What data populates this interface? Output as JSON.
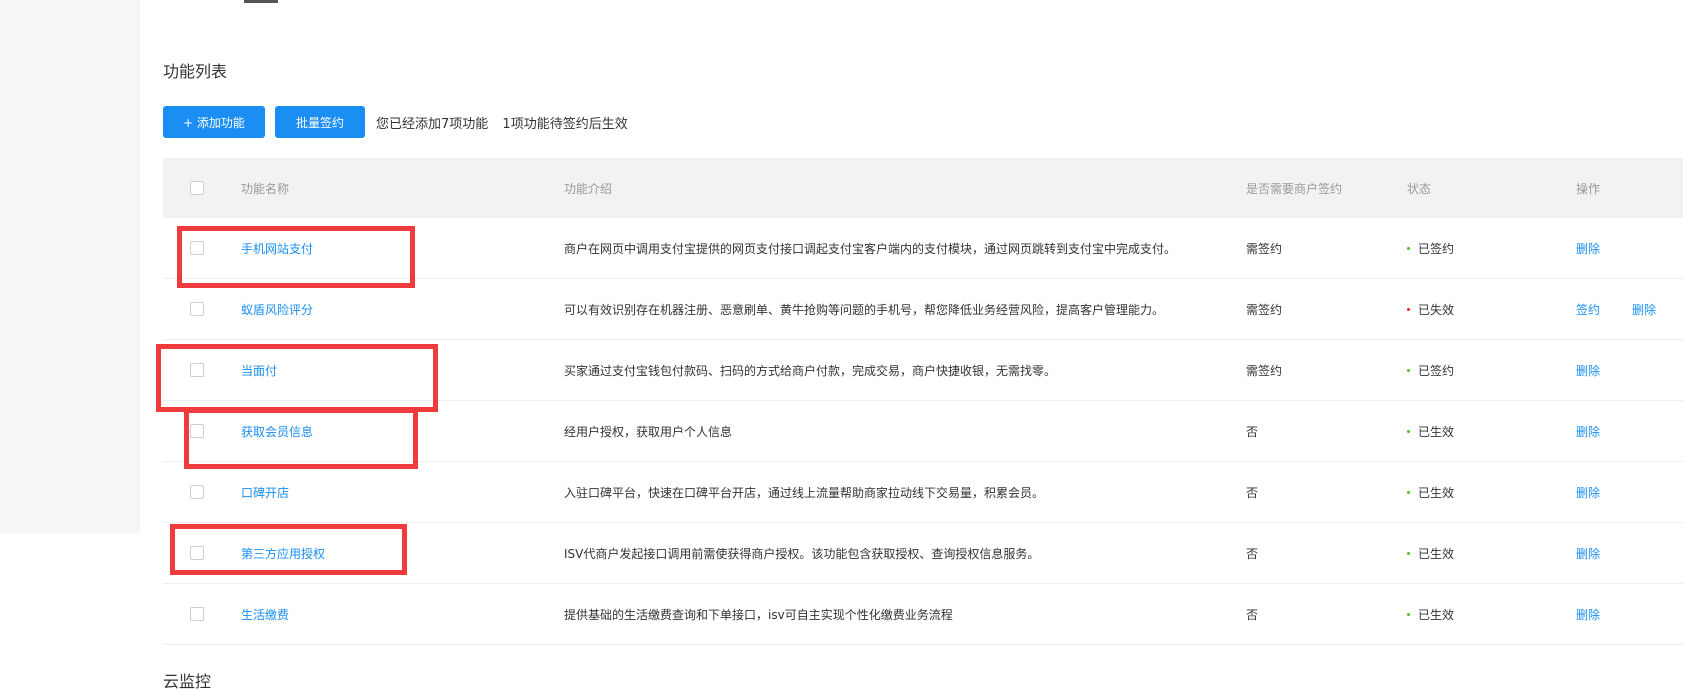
{
  "section": {
    "title": "功能列表",
    "next_title": "云监控"
  },
  "toolbar": {
    "add_label": "+ 添加功能",
    "batch_label": "批量签约",
    "info_added": "您已经添加7项功能",
    "info_pending": "1项功能待签约后生效"
  },
  "table": {
    "headers": {
      "name": "功能名称",
      "desc": "功能介绍",
      "sign": "是否需要商户签约",
      "status": "状态",
      "ops": "操作"
    },
    "rows": [
      {
        "name": "手机网站支付",
        "desc": "商户在网页中调用支付宝提供的网页支付接口调起支付宝客户端内的支付模块，通过网页跳转到支付宝中完成支付。",
        "sign": "需签约",
        "status": "已签约",
        "ops": [
          "删除"
        ]
      },
      {
        "name": "蚁盾风险评分",
        "desc": "可以有效识别存在机器注册、恶意刷单、黄牛抢购等问题的手机号，帮您降低业务经营风险，提高客户管理能力。",
        "sign": "需签约",
        "status": "已失效",
        "ops": [
          "签约",
          "删除"
        ]
      },
      {
        "name": "当面付",
        "desc": "买家通过支付宝钱包付款码、扫码的方式给商户付款，完成交易，商户快捷收银，无需找零。",
        "sign": "需签约",
        "status": "已签约",
        "ops": [
          "删除"
        ]
      },
      {
        "name": "获取会员信息",
        "desc": "经用户授权，获取用户个人信息",
        "sign": "否",
        "status": "已生效",
        "ops": [
          "删除"
        ]
      },
      {
        "name": "口碑开店",
        "desc": "入驻口碑平台，快速在口碑平台开店，通过线上流量帮助商家拉动线下交易量，积累会员。",
        "sign": "否",
        "status": "已生效",
        "ops": [
          "删除"
        ]
      },
      {
        "name": "第三方应用授权",
        "desc": "ISV代商户发起接口调用前需使获得商户授权。该功能包含获取授权、查询授权信息服务。",
        "sign": "否",
        "status": "已生效",
        "ops": [
          "删除"
        ]
      },
      {
        "name": "生活缴费",
        "desc": "提供基础的生活缴费查询和下单接口，isv可自主实现个性化缴费业务流程",
        "sign": "否",
        "status": "已生效",
        "ops": [
          "删除"
        ]
      }
    ]
  },
  "colors": {
    "accent": "#1a8ef2",
    "status_ok": "#52c41a",
    "status_invalid": "#f5222d",
    "annotation": "#ef3b3b"
  }
}
